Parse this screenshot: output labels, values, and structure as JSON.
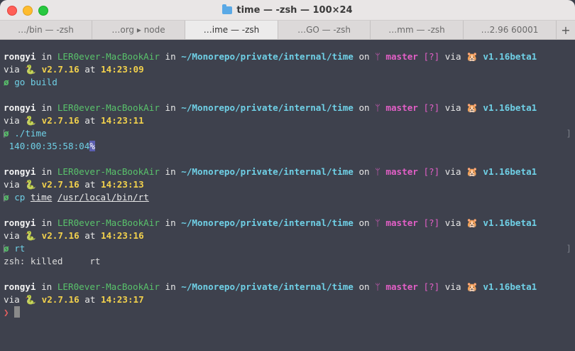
{
  "window": {
    "title": "time — -zsh — 100×24"
  },
  "tabs": [
    {
      "label": "…/bin — -zsh",
      "active": false
    },
    {
      "label": "…org ▸ node",
      "active": false
    },
    {
      "label": "…ime — -zsh",
      "active": true
    },
    {
      "label": "…GO — -zsh",
      "active": false
    },
    {
      "label": "…mm — -zsh",
      "active": false
    },
    {
      "label": "…2.96 60001",
      "active": false
    }
  ],
  "tab_add_label": "+",
  "icons": {
    "folder": "folder-icon",
    "branch": "git-branch-icon",
    "hamster": "go-gopher-icon",
    "snake": "python-icon"
  },
  "prompt": {
    "user": "rongyi",
    "in": " in ",
    "host": "LER0ever-MacBookAir",
    "path": "~/Monorepo/private/internal/time",
    "on": " on ",
    "branch": "master",
    "status": "[?]",
    "via": " via ",
    "go_version": "v1.16beta1",
    "via2": "via ",
    "py_version": "v2.7.16",
    "at": " at "
  },
  "blocks": [
    {
      "time": "14:23:09",
      "command": "go build",
      "output": []
    },
    {
      "time": "14:23:11",
      "command": "./time",
      "output": [
        "140:00:35:58:04"
      ],
      "selected_char": "%"
    },
    {
      "time": "14:23:13",
      "command_prefix": "cp",
      "args": [
        "time",
        "/usr/local/bin/rt"
      ],
      "output": []
    },
    {
      "time": "14:23:16",
      "command": "rt",
      "output": [
        "zsh: killed     rt"
      ]
    },
    {
      "time": "14:23:17"
    }
  ],
  "symbols": {
    "success": "ø",
    "prompt_char": "❯",
    "bracket_left": "[",
    "bracket_right": "]"
  },
  "colors": {
    "terminal_bg": "#3e414d",
    "host": "#59c26b",
    "path": "#6fd0e6",
    "branch": "#e25fc6",
    "time": "#f2d14c",
    "error": "#e25f5f"
  }
}
